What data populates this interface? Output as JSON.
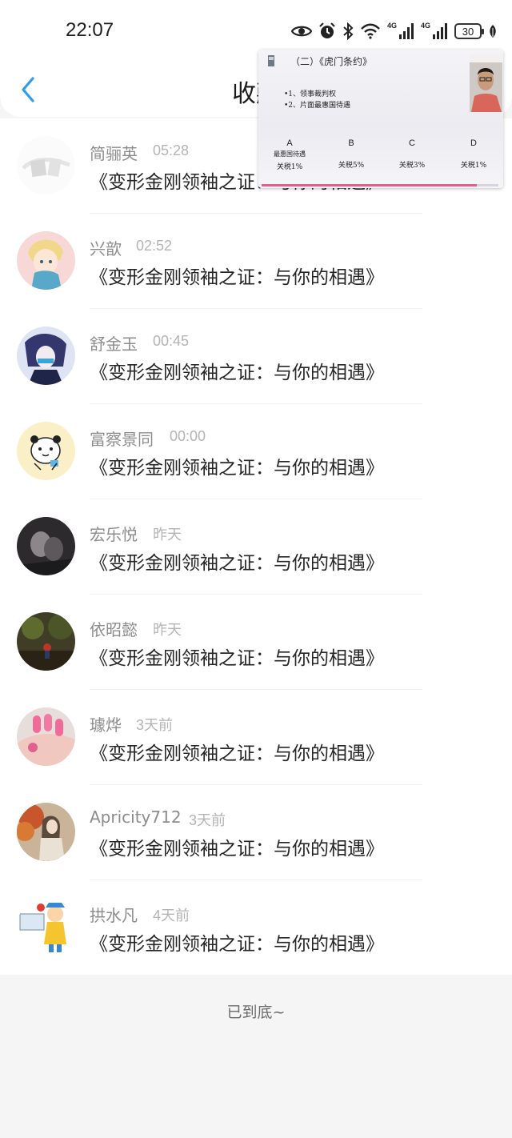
{
  "status_bar": {
    "time": "22:07",
    "network_1": "4G",
    "network_2": "4G",
    "battery": "30",
    "icons": [
      "eye-icon",
      "alarm-icon",
      "bluetooth-icon",
      "wifi-icon",
      "signal-icon",
      "signal-icon",
      "battery-icon",
      "leaf-icon"
    ]
  },
  "header": {
    "title": "收藏",
    "back_icon": "chevron-left-icon"
  },
  "list": {
    "items": [
      {
        "name": "简骊英",
        "time": "05:28",
        "title": "《变形金刚领袖之证：与你的相遇》"
      },
      {
        "name": "兴歆",
        "time": "02:52",
        "title": "《变形金刚领袖之证：与你的相遇》"
      },
      {
        "name": "舒金玉",
        "time": "00:45",
        "title": "《变形金刚领袖之证：与你的相遇》"
      },
      {
        "name": "富察景同",
        "time": "00:00",
        "title": "《变形金刚领袖之证：与你的相遇》"
      },
      {
        "name": "宏乐悦",
        "time": "昨天",
        "title": "《变形金刚领袖之证：与你的相遇》"
      },
      {
        "name": "依昭懿",
        "time": "昨天",
        "title": "《变形金刚领袖之证：与你的相遇》"
      },
      {
        "name": "璩烨",
        "time": "3天前",
        "title": "《变形金刚领袖之证：与你的相遇》"
      },
      {
        "name": "Apricity712",
        "time": "3天前",
        "title": "《变形金刚领袖之证：与你的相遇》"
      },
      {
        "name": "拱水凡",
        "time": "4天前",
        "title": "《变形金刚领袖之证：与你的相遇》"
      }
    ]
  },
  "footer": {
    "end_text": "已到底~"
  },
  "video_overlay": {
    "slide_title": "（二）《虎门条约》",
    "bullets": [
      "•1、领事裁判权",
      "•2、片面最惠国待遇"
    ],
    "columns": [
      "A",
      "B",
      "C",
      "D"
    ],
    "column_sub": "最惠国待遇",
    "taxes": [
      "关税1%",
      "关税5%",
      "关税3%",
      "关税1%"
    ],
    "progress": 0.91
  },
  "colors": {
    "accent": "#2e9fe6",
    "background": "#f6f5f6",
    "name_text": "#8c8c8c",
    "time_text": "#b4b4b4",
    "progress": "#e85c8a"
  }
}
